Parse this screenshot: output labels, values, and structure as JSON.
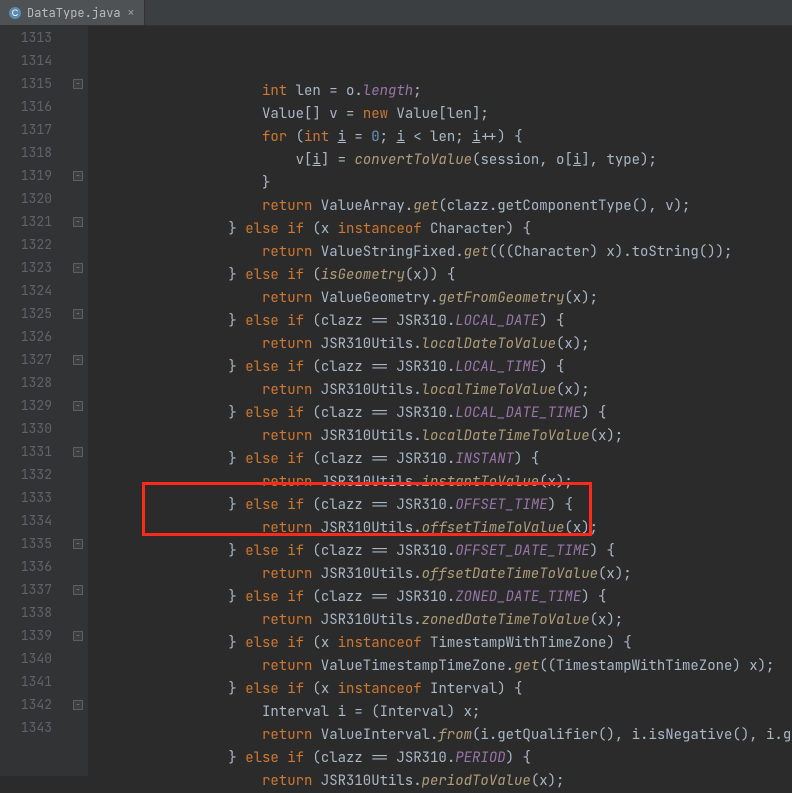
{
  "tab": {
    "filename": "DataType.java",
    "icon": "java-class-icon"
  },
  "gutter": {
    "start": 1313,
    "end": 1343
  },
  "code": {
    "lines": [
      {
        "indent": 20,
        "tokens": [
          {
            "t": "kw",
            "v": "int"
          },
          {
            "t": "op",
            "v": " len = o."
          },
          {
            "t": "field",
            "v": "length"
          },
          {
            "t": "punc",
            "v": ";"
          }
        ]
      },
      {
        "indent": 20,
        "tokens": [
          {
            "t": "type",
            "v": "Value[] v = "
          },
          {
            "t": "kw",
            "v": "new"
          },
          {
            "t": "type",
            "v": " Value[len];"
          }
        ]
      },
      {
        "indent": 20,
        "tokens": [
          {
            "t": "kw",
            "v": "for"
          },
          {
            "t": "punc",
            "v": " ("
          },
          {
            "t": "kw",
            "v": "int"
          },
          {
            "t": "op",
            "v": " "
          },
          {
            "t": "u",
            "v": "i"
          },
          {
            "t": "op",
            "v": " = "
          },
          {
            "t": "num",
            "v": "0"
          },
          {
            "t": "punc",
            "v": "; "
          },
          {
            "t": "u",
            "v": "i"
          },
          {
            "t": "op",
            "v": " < len; "
          },
          {
            "t": "u",
            "v": "i"
          },
          {
            "t": "op",
            "v": "++) {"
          }
        ]
      },
      {
        "indent": 24,
        "tokens": [
          {
            "t": "op",
            "v": "v["
          },
          {
            "t": "u",
            "v": "i"
          },
          {
            "t": "op",
            "v": "] = "
          },
          {
            "t": "italic-method",
            "v": "convertToValue"
          },
          {
            "t": "punc",
            "v": "(session, o["
          },
          {
            "t": "u",
            "v": "i"
          },
          {
            "t": "punc",
            "v": "], type);"
          }
        ]
      },
      {
        "indent": 20,
        "tokens": [
          {
            "t": "punc",
            "v": "}"
          }
        ]
      },
      {
        "indent": 20,
        "tokens": [
          {
            "t": "kw",
            "v": "return"
          },
          {
            "t": "op",
            "v": " ValueArray."
          },
          {
            "t": "italic-method",
            "v": "get"
          },
          {
            "t": "punc",
            "v": "(clazz.getComponentType(), v);"
          }
        ]
      },
      {
        "indent": 16,
        "tokens": [
          {
            "t": "punc",
            "v": "} "
          },
          {
            "t": "kw",
            "v": "else if"
          },
          {
            "t": "punc",
            "v": " (x "
          },
          {
            "t": "kw",
            "v": "instanceof"
          },
          {
            "t": "punc",
            "v": " Character) {"
          }
        ]
      },
      {
        "indent": 20,
        "tokens": [
          {
            "t": "kw",
            "v": "return"
          },
          {
            "t": "op",
            "v": " ValueStringFixed."
          },
          {
            "t": "italic-method",
            "v": "get"
          },
          {
            "t": "punc",
            "v": "(((Character) x).toString());"
          }
        ]
      },
      {
        "indent": 16,
        "tokens": [
          {
            "t": "punc",
            "v": "} "
          },
          {
            "t": "kw",
            "v": "else if"
          },
          {
            "t": "punc",
            "v": " ("
          },
          {
            "t": "italic-method",
            "v": "isGeometry"
          },
          {
            "t": "punc",
            "v": "(x)) {"
          }
        ]
      },
      {
        "indent": 20,
        "tokens": [
          {
            "t": "kw",
            "v": "return"
          },
          {
            "t": "op",
            "v": " ValueGeometry."
          },
          {
            "t": "italic-method",
            "v": "getFromGeometry"
          },
          {
            "t": "punc",
            "v": "(x);"
          }
        ]
      },
      {
        "indent": 16,
        "tokens": [
          {
            "t": "punc",
            "v": "} "
          },
          {
            "t": "kw",
            "v": "else if"
          },
          {
            "t": "punc",
            "v": " (clazz == JSR310."
          },
          {
            "t": "field",
            "v": "LOCAL_DATE"
          },
          {
            "t": "punc",
            "v": ") {"
          }
        ]
      },
      {
        "indent": 20,
        "tokens": [
          {
            "t": "kw",
            "v": "return"
          },
          {
            "t": "op",
            "v": " JSR310Utils."
          },
          {
            "t": "italic-method",
            "v": "localDateToValue"
          },
          {
            "t": "punc",
            "v": "(x);"
          }
        ]
      },
      {
        "indent": 16,
        "tokens": [
          {
            "t": "punc",
            "v": "} "
          },
          {
            "t": "kw",
            "v": "else if"
          },
          {
            "t": "punc",
            "v": " (clazz == JSR310."
          },
          {
            "t": "field",
            "v": "LOCAL_TIME"
          },
          {
            "t": "punc",
            "v": ") {"
          }
        ]
      },
      {
        "indent": 20,
        "tokens": [
          {
            "t": "kw",
            "v": "return"
          },
          {
            "t": "op",
            "v": " JSR310Utils."
          },
          {
            "t": "italic-method",
            "v": "localTimeToValue"
          },
          {
            "t": "punc",
            "v": "(x);"
          }
        ]
      },
      {
        "indent": 16,
        "tokens": [
          {
            "t": "punc",
            "v": "} "
          },
          {
            "t": "kw",
            "v": "else if"
          },
          {
            "t": "punc",
            "v": " (clazz == JSR310."
          },
          {
            "t": "field",
            "v": "LOCAL_DATE_TIME"
          },
          {
            "t": "punc",
            "v": ") {"
          }
        ]
      },
      {
        "indent": 20,
        "tokens": [
          {
            "t": "kw",
            "v": "return"
          },
          {
            "t": "op",
            "v": " JSR310Utils."
          },
          {
            "t": "italic-method",
            "v": "localDateTimeToValue"
          },
          {
            "t": "punc",
            "v": "(x);"
          }
        ]
      },
      {
        "indent": 16,
        "tokens": [
          {
            "t": "punc",
            "v": "} "
          },
          {
            "t": "kw",
            "v": "else if"
          },
          {
            "t": "punc",
            "v": " (clazz == JSR310."
          },
          {
            "t": "field",
            "v": "INSTANT"
          },
          {
            "t": "punc",
            "v": ") {"
          }
        ]
      },
      {
        "indent": 20,
        "tokens": [
          {
            "t": "kw",
            "v": "return"
          },
          {
            "t": "op",
            "v": " JSR310Utils."
          },
          {
            "t": "italic-method",
            "v": "instantToValue"
          },
          {
            "t": "punc",
            "v": "(x);"
          }
        ]
      },
      {
        "indent": 16,
        "tokens": [
          {
            "t": "punc",
            "v": "} "
          },
          {
            "t": "kw",
            "v": "else if"
          },
          {
            "t": "punc",
            "v": " (clazz == JSR310."
          },
          {
            "t": "field",
            "v": "OFFSET_TIME"
          },
          {
            "t": "punc",
            "v": ") {"
          }
        ]
      },
      {
        "indent": 20,
        "tokens": [
          {
            "t": "kw",
            "v": "return"
          },
          {
            "t": "op",
            "v": " JSR310Utils."
          },
          {
            "t": "italic-method",
            "v": "offsetTimeToValue"
          },
          {
            "t": "punc",
            "v": "(x);"
          }
        ]
      },
      {
        "indent": 16,
        "tokens": [
          {
            "t": "punc",
            "v": "} "
          },
          {
            "t": "kw",
            "v": "else if"
          },
          {
            "t": "punc",
            "v": " (clazz == JSR310."
          },
          {
            "t": "field",
            "v": "OFFSET_DATE_TIME"
          },
          {
            "t": "punc",
            "v": ") {"
          }
        ]
      },
      {
        "indent": 20,
        "tokens": [
          {
            "t": "kw",
            "v": "return"
          },
          {
            "t": "op",
            "v": " JSR310Utils."
          },
          {
            "t": "italic-method",
            "v": "offsetDateTimeToValue"
          },
          {
            "t": "punc",
            "v": "(x);"
          }
        ]
      },
      {
        "indent": 16,
        "tokens": [
          {
            "t": "punc",
            "v": "} "
          },
          {
            "t": "kw",
            "v": "else if"
          },
          {
            "t": "punc",
            "v": " (clazz == JSR310."
          },
          {
            "t": "field",
            "v": "ZONED_DATE_TIME"
          },
          {
            "t": "punc",
            "v": ") {"
          }
        ]
      },
      {
        "indent": 20,
        "tokens": [
          {
            "t": "kw",
            "v": "return"
          },
          {
            "t": "op",
            "v": " JSR310Utils."
          },
          {
            "t": "italic-method",
            "v": "zonedDateTimeToValue"
          },
          {
            "t": "punc",
            "v": "(x);"
          }
        ]
      },
      {
        "indent": 16,
        "tokens": [
          {
            "t": "punc",
            "v": "} "
          },
          {
            "t": "kw",
            "v": "else if"
          },
          {
            "t": "punc",
            "v": " (x "
          },
          {
            "t": "kw",
            "v": "instanceof"
          },
          {
            "t": "punc",
            "v": " TimestampWithTimeZone) {"
          }
        ]
      },
      {
        "indent": 20,
        "tokens": [
          {
            "t": "kw",
            "v": "return"
          },
          {
            "t": "op",
            "v": " ValueTimestampTimeZone."
          },
          {
            "t": "italic-method",
            "v": "get"
          },
          {
            "t": "punc",
            "v": "((TimestampWithTimeZone) x);"
          }
        ]
      },
      {
        "indent": 16,
        "tokens": [
          {
            "t": "punc",
            "v": "} "
          },
          {
            "t": "kw",
            "v": "else if"
          },
          {
            "t": "punc",
            "v": " (x "
          },
          {
            "t": "kw",
            "v": "instanceof"
          },
          {
            "t": "punc",
            "v": " Interval) {"
          }
        ]
      },
      {
        "indent": 20,
        "tokens": [
          {
            "t": "type",
            "v": "Interval i = (Interval) x;"
          }
        ]
      },
      {
        "indent": 20,
        "tokens": [
          {
            "t": "kw",
            "v": "return"
          },
          {
            "t": "op",
            "v": " ValueInterval."
          },
          {
            "t": "italic-method",
            "v": "from"
          },
          {
            "t": "punc",
            "v": "(i.getQualifier(), i.isNegative(), i.getLe"
          }
        ]
      },
      {
        "indent": 16,
        "tokens": [
          {
            "t": "punc",
            "v": "} "
          },
          {
            "t": "kw",
            "v": "else if"
          },
          {
            "t": "punc",
            "v": " (clazz == JSR310."
          },
          {
            "t": "field",
            "v": "PERIOD"
          },
          {
            "t": "punc",
            "v": ") {"
          }
        ]
      },
      {
        "indent": 20,
        "tokens": [
          {
            "t": "kw",
            "v": "return"
          },
          {
            "t": "op",
            "v": " JSR310Utils."
          },
          {
            "t": "italic-method",
            "v": "periodToValue"
          },
          {
            "t": "punc",
            "v": "(x);"
          }
        ]
      }
    ]
  },
  "highlight": {
    "startLine": 1333,
    "endLine": 1334
  },
  "foldMarkers": [
    1315,
    1319,
    1321,
    1323,
    1325,
    1327,
    1329,
    1331,
    1335,
    1337,
    1339,
    1342
  ]
}
